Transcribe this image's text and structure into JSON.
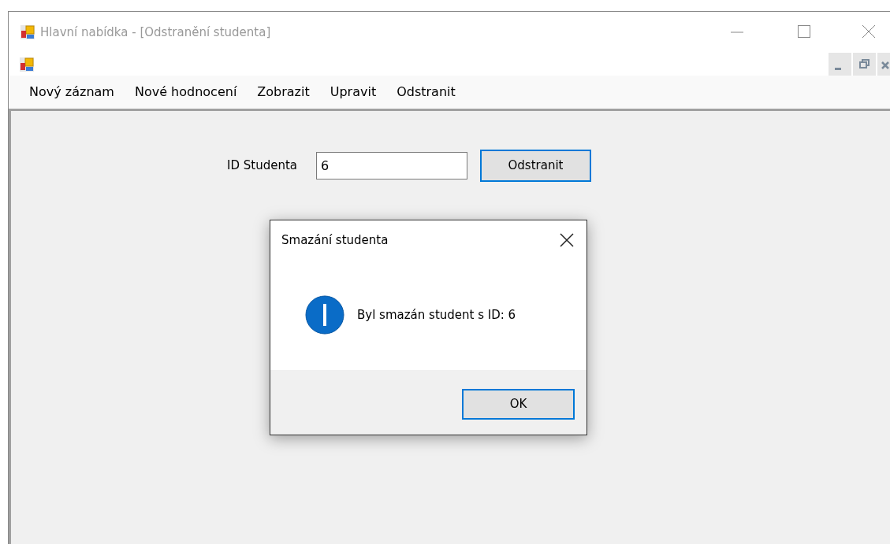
{
  "window": {
    "title": "Hlavní nabídka - [Odstranění studenta]",
    "active": false
  },
  "menu": [
    {
      "label": "Nový záznam"
    },
    {
      "label": "Nové hodnocení"
    },
    {
      "label": "Zobrazit"
    },
    {
      "label": "Upravit"
    },
    {
      "label": "Odstranit"
    }
  ],
  "form": {
    "label": "ID Studenta",
    "value": "6",
    "button": {
      "label": "Odstranit",
      "focused": true
    }
  },
  "dialog": {
    "title": "Smazání studenta",
    "message": "Byl smazán student s ID: 6",
    "button": {
      "label": "OK",
      "focused": true
    }
  }
}
